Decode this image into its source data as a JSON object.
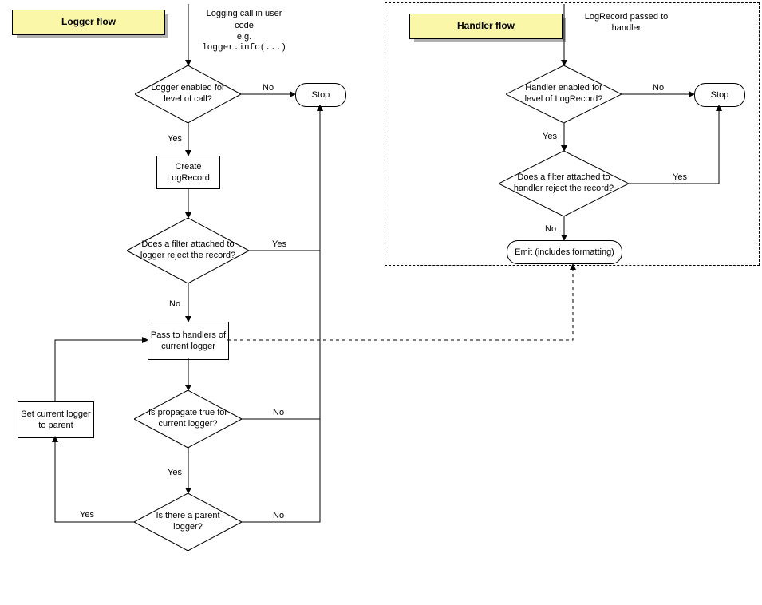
{
  "titles": {
    "logger": "Logger flow",
    "handler": "Handler flow"
  },
  "logger": {
    "start_line1": "Logging call in user",
    "start_line2": "code",
    "start_line3": "e.g.",
    "start_code": "logger.info(...)",
    "decision_enabled": "Logger enabled for level of call?",
    "stop": "Stop",
    "create_record": "Create LogRecord",
    "decision_filter": "Does a filter attached to logger reject the record?",
    "pass_handlers": "Pass to handlers of current logger",
    "decision_propagate": "Is propagate true for current logger?",
    "decision_parent": "Is there a parent logger?",
    "set_parent": "Set current logger to parent",
    "labels": {
      "enabled_no": "No",
      "enabled_yes": "Yes",
      "filter_yes": "Yes",
      "filter_no": "No",
      "propagate_no": "No",
      "propagate_yes": "Yes",
      "parent_yes": "Yes",
      "parent_no": "No"
    }
  },
  "handler": {
    "start_line1": "LogRecord passed to",
    "start_line2": "handler",
    "decision_enabled": "Handler enabled for level of LogRecord?",
    "stop": "Stop",
    "decision_filter": "Does a filter attached to handler reject the record?",
    "emit": "Emit (includes formatting)",
    "labels": {
      "enabled_no": "No",
      "enabled_yes": "Yes",
      "filter_yes": "Yes",
      "filter_no": "No"
    }
  }
}
